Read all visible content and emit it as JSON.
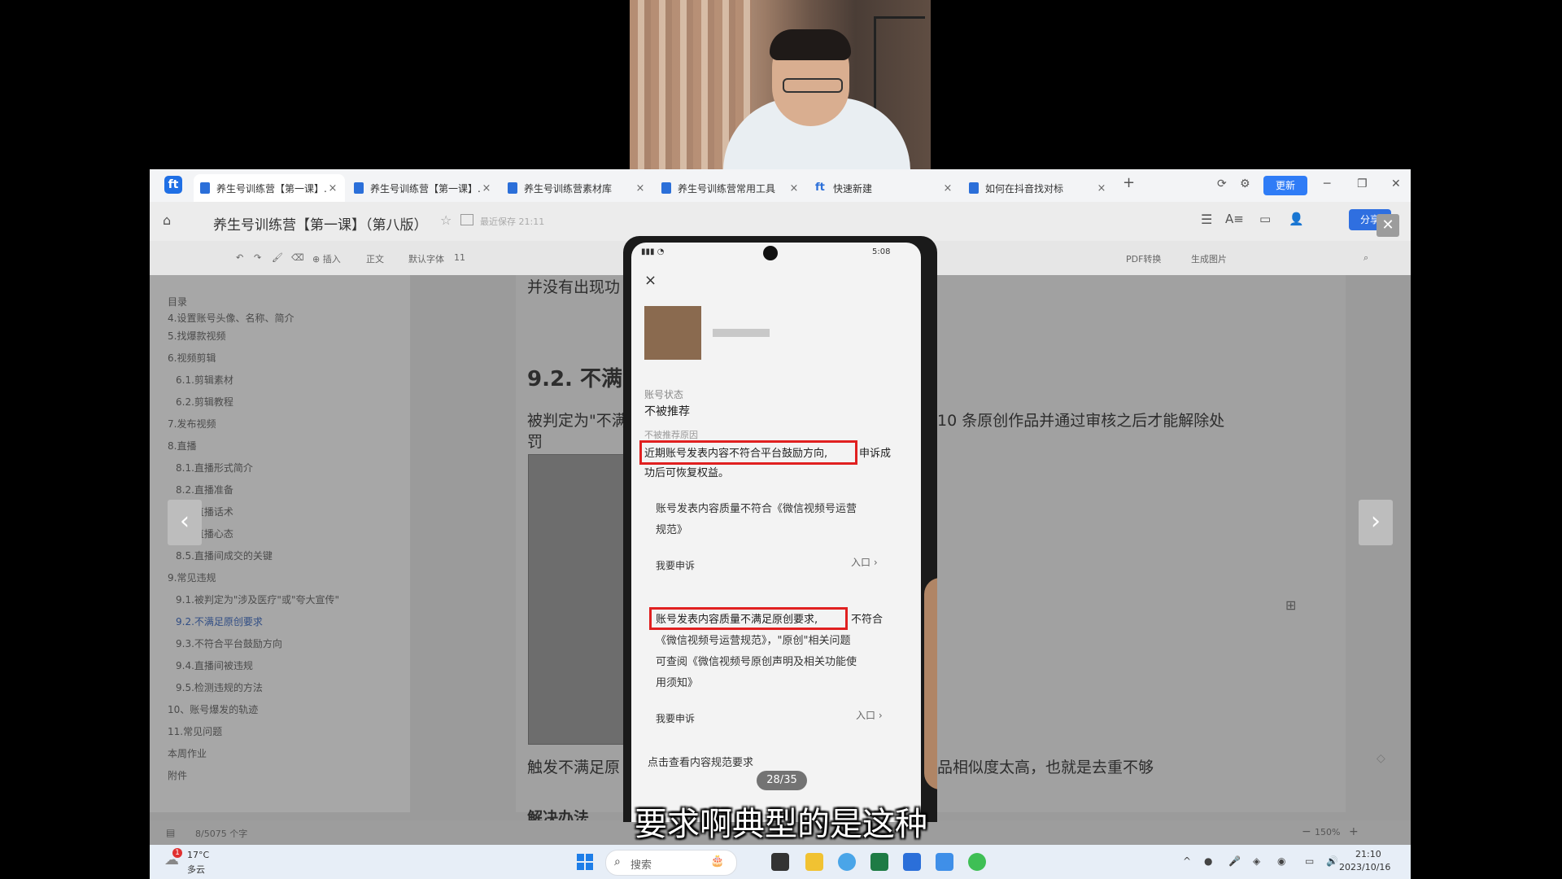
{
  "tabs": [
    {
      "label": "养生号训练营【第一课】...",
      "active": true,
      "icon": "doc-icon"
    },
    {
      "label": "养生号训练营【第一课】...",
      "active": false,
      "icon": "doc-icon"
    },
    {
      "label": "养生号训练营素材库",
      "active": false,
      "icon": "doc-icon"
    },
    {
      "label": "养生号训练营常用工具",
      "active": false,
      "icon": "doc-icon"
    },
    {
      "label": "快速新建",
      "active": false,
      "icon": "kdocs-icon"
    },
    {
      "label": "如何在抖音找对标",
      "active": false,
      "icon": "doc-icon"
    }
  ],
  "window_controls": {
    "update": "更新",
    "minimize": "─",
    "restore": "❐",
    "close": "✕",
    "new_tab": "+"
  },
  "header": {
    "title": "养生号训练营【第一课】（第八版）",
    "saved": "最近保存 21:11",
    "share": "分享",
    "close_viewer": "✕"
  },
  "toolbar": {
    "insert": "插入",
    "style": "正文",
    "font": "默认字体",
    "size": "11",
    "pdf": "PDF转换",
    "gen_image": "生成图片"
  },
  "toc": {
    "header": "目录",
    "items": [
      {
        "label": "4.设置账号头像、名称、简介",
        "indent": 0,
        "selected": false
      },
      {
        "label": "5.找爆款视频",
        "indent": 0,
        "selected": false
      },
      {
        "label": "6.视频剪辑",
        "indent": 0,
        "selected": false
      },
      {
        "label": "6.1.剪辑素材",
        "indent": 1,
        "selected": false
      },
      {
        "label": "6.2.剪辑教程",
        "indent": 1,
        "selected": false
      },
      {
        "label": "7.发布视频",
        "indent": 0,
        "selected": false
      },
      {
        "label": "8.直播",
        "indent": 0,
        "selected": false
      },
      {
        "label": "8.1.直播形式简介",
        "indent": 1,
        "selected": false
      },
      {
        "label": "8.2.直播准备",
        "indent": 1,
        "selected": false
      },
      {
        "label": "8.3.直播话术",
        "indent": 1,
        "selected": false
      },
      {
        "label": "8.4.直播心态",
        "indent": 1,
        "selected": false
      },
      {
        "label": "8.5.直播间成交的关键",
        "indent": 1,
        "selected": false
      },
      {
        "label": "9.常见违规",
        "indent": 0,
        "selected": false
      },
      {
        "label": "9.1.被判定为\"涉及医疗\"或\"夸大宣传\"",
        "indent": 1,
        "selected": false
      },
      {
        "label": "9.2.不满足原创要求",
        "indent": 1,
        "selected": true
      },
      {
        "label": "9.3.不符合平台鼓励方向",
        "indent": 1,
        "selected": false
      },
      {
        "label": "9.4.直播间被违规",
        "indent": 1,
        "selected": false
      },
      {
        "label": "9.5.检测违规的方法",
        "indent": 1,
        "selected": false
      },
      {
        "label": "10、账号爆发的轨迹",
        "indent": 0,
        "selected": false
      },
      {
        "label": "11.常见问题",
        "indent": 0,
        "selected": false
      },
      {
        "label": "本周作业",
        "indent": 0,
        "selected": false
      },
      {
        "label": "附件",
        "indent": 0,
        "selected": false
      }
    ]
  },
  "document": {
    "line_top": "并没有出现功",
    "heading": "9.2.  不满",
    "para1_left": "被判定为\"不满",
    "para1_right": "10 条原创作品并通过审核之后才能解除处",
    "para1_line2": "罚",
    "para2_left": "触发不满足原",
    "para2_right": "品相似度太高，也就是去重不够",
    "heading2": "解决办法"
  },
  "status": {
    "word_count": "8/5075 个字",
    "zoom": "150%"
  },
  "phone": {
    "time": "5:08",
    "account_status_label": "账号状态",
    "account_status_value": "不被推荐",
    "reason_label": "不被推荐原因",
    "reason1_highlight": "近期账号发表内容不符合平台鼓励方向,",
    "reason1_rest": "申诉成",
    "reason1_line2": "功后可恢复权益。",
    "item1_line1": "账号发表内容质量不符合《微信视频号运营",
    "item1_line2": "规范》",
    "appeal": "我要申诉",
    "entry": "入口",
    "item2_highlight": "账号发表内容质量不满足原创要求,",
    "item2_rest": "不符合",
    "item2_line2": "《微信视频号运营规范》，\"原创\"相关问题",
    "item2_line3": "可查阅《微信视频号原创声明及相关功能使",
    "item2_line4": "用须知》",
    "view_rules": "点击查看内容规范要求",
    "counter": "28/35"
  },
  "subtitle": "要求啊典型的是这种",
  "taskbar": {
    "weather_temp": "17°C",
    "weather_desc": "多云",
    "weather_badge": "1",
    "search": "搜索",
    "clock_time": "21:10",
    "clock_date": "2023/10/16"
  },
  "colors": {
    "accent": "#2f7cf6",
    "highlight_box": "#e02020",
    "selected_toc": "#304d84"
  }
}
